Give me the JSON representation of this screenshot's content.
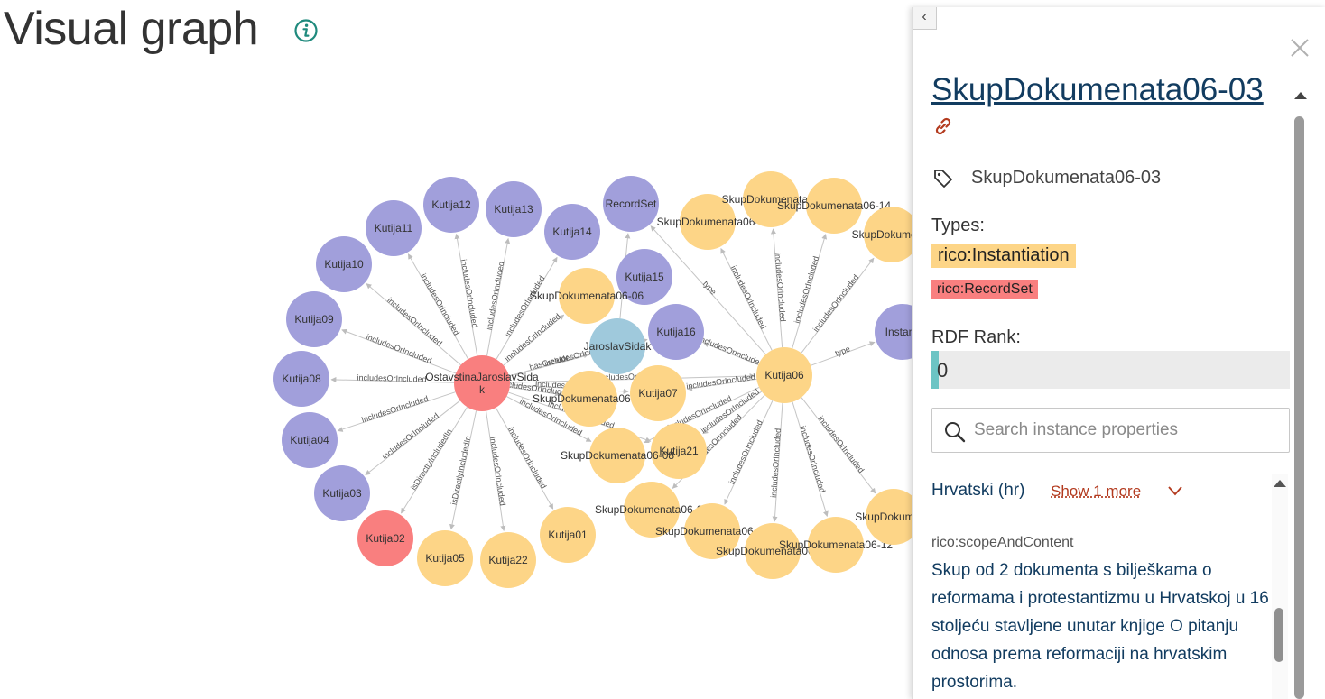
{
  "page": {
    "title": "Visual graph"
  },
  "graph": {
    "colors": {
      "purple": "#a19fdb",
      "yellow": "#fdd587",
      "red": "#f97f7f",
      "blue": "#9fc9dc"
    },
    "nodes": [
      {
        "id": "center",
        "label": "OstavstinaJaroslavSida k",
        "color": "red"
      },
      {
        "id": "k12",
        "label": "Kutija12",
        "color": "purple"
      },
      {
        "id": "k13",
        "label": "Kutija13",
        "color": "purple"
      },
      {
        "id": "k11",
        "label": "Kutija11",
        "color": "purple"
      },
      {
        "id": "k10",
        "label": "Kutija10",
        "color": "purple"
      },
      {
        "id": "k09",
        "label": "Kutija09",
        "color": "purple"
      },
      {
        "id": "k08",
        "label": "Kutija08",
        "color": "purple"
      },
      {
        "id": "k04",
        "label": "Kutija04",
        "color": "purple"
      },
      {
        "id": "k03",
        "label": "Kutija03",
        "color": "purple"
      },
      {
        "id": "k02",
        "label": "Kutija02",
        "color": "red"
      },
      {
        "id": "k05",
        "label": "Kutija05",
        "color": "yellow"
      },
      {
        "id": "k22",
        "label": "Kutija22",
        "color": "yellow"
      },
      {
        "id": "k01",
        "label": "Kutija01",
        "color": "yellow"
      },
      {
        "id": "k14",
        "label": "Kutija14",
        "color": "purple"
      },
      {
        "id": "recordset",
        "label": "RecordSet",
        "color": "purple"
      },
      {
        "id": "k15",
        "label": "Kutija15",
        "color": "purple"
      },
      {
        "id": "k16",
        "label": "Kutija16",
        "color": "purple"
      },
      {
        "id": "sd0606",
        "label": "SkupDokumenata06-06",
        "color": "yellow"
      },
      {
        "id": "jaroslav",
        "label": "JaroslavSidak",
        "color": "blue"
      },
      {
        "id": "sd0609",
        "label": "SkupDokumenata06-09",
        "color": "yellow"
      },
      {
        "id": "k07",
        "label": "Kutija07",
        "color": "yellow"
      },
      {
        "id": "k21",
        "label": "Kutija21",
        "color": "yellow"
      },
      {
        "id": "sd0608",
        "label": "SkupDokumenata06-08",
        "color": "yellow"
      },
      {
        "id": "sd0602",
        "label": "SkupDokumenata06-02",
        "color": "yellow"
      },
      {
        "id": "k06",
        "label": "Kutija06",
        "color": "yellow"
      },
      {
        "id": "sd06a",
        "label": "SkupDokumenata06-",
        "color": "yellow"
      },
      {
        "id": "sd06b",
        "label": "SkupDokumenata06",
        "color": "yellow"
      },
      {
        "id": "sd0614",
        "label": "SkupDokumenata06-14",
        "color": "yellow"
      },
      {
        "id": "sd06c",
        "label": "SkupDokumenat",
        "color": "yellow"
      },
      {
        "id": "instantiation",
        "label": "Instanti",
        "color": "purple"
      },
      {
        "id": "sd0616",
        "label": "SkupDokumenata06-16",
        "color": "yellow"
      },
      {
        "id": "sd0615",
        "label": "SkupDokumenata06-15",
        "color": "yellow"
      },
      {
        "id": "sd0612",
        "label": "SkupDokumenata06-12",
        "color": "yellow"
      },
      {
        "id": "sd06d",
        "label": "SkupDokumena",
        "color": "yellow"
      }
    ],
    "edge_labels": {
      "includes": "includesOrIncluded",
      "type": "type",
      "isDirectly": "isDirectlyIncludedIn",
      "hasCreator": "hasCreator"
    }
  },
  "panel": {
    "collapse_glyph": "‹",
    "title": "SkupDokumenata06-03",
    "tag_label": "SkupDokumenata06-03",
    "types_heading": "Types:",
    "types": [
      "rico:Instantiation",
      "rico:RecordSet"
    ],
    "rank_heading": "RDF Rank:",
    "rank_value": "0",
    "rank_fraction": 0.0,
    "search": {
      "placeholder": "Search instance properties"
    },
    "language": "Hrvatski (hr)",
    "show_more": "Show 1 more",
    "property_name": "rico:scopeAndContent",
    "property_value": "Skup od 2 dokumenta s bilješkama o reformama i protestantizmu u Hrvatskoj u 16. stoljeću stavljene unutar knjige O pitanju odnosa prema reformaciji na hrvatskim prostorima.",
    "accent_color": "#123c60",
    "link_color": "#b33a1e"
  }
}
